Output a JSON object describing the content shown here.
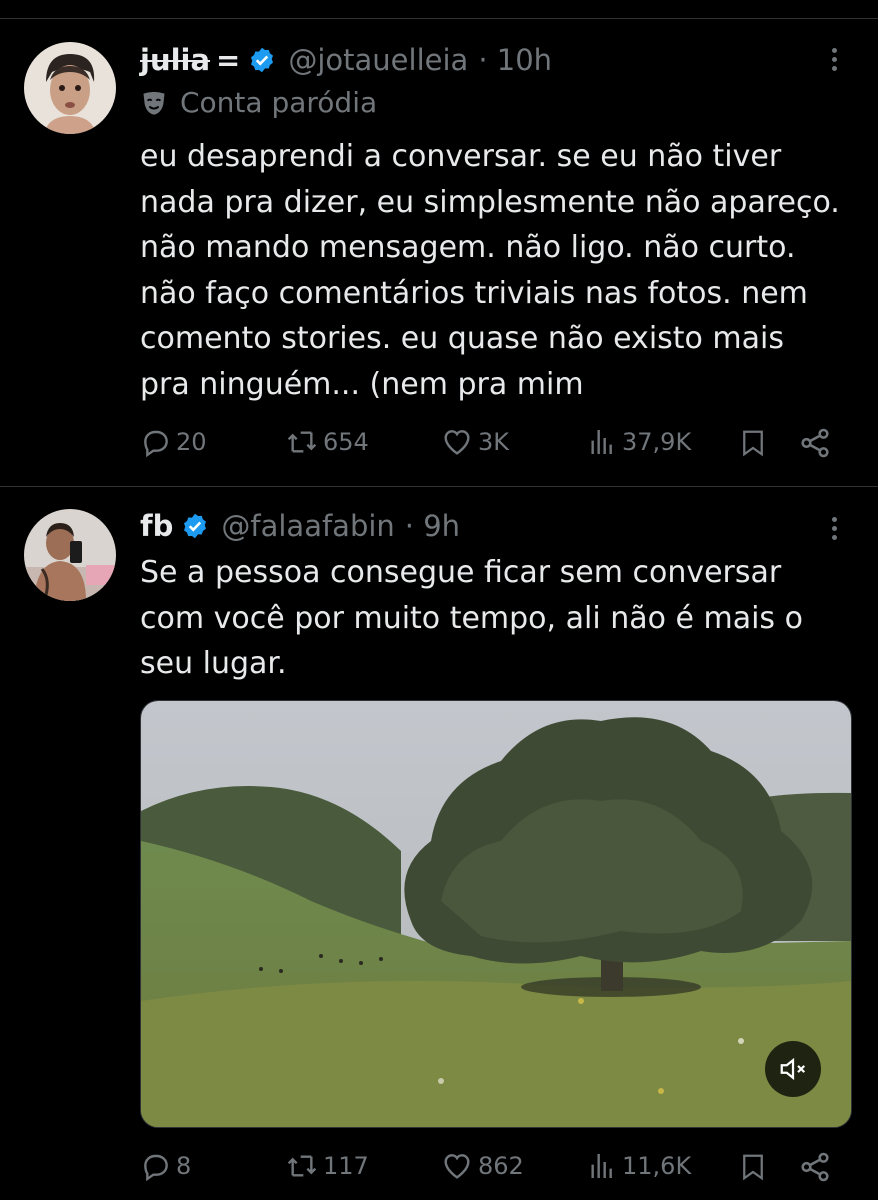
{
  "tweets": [
    {
      "name": "julia",
      "name_suffix": "=",
      "handle": "@jotauelleia",
      "time": "· 10h",
      "parody_label": "Conta paródia",
      "text": "eu desaprendi a conversar. se eu não tiver nada pra dizer, eu simplesmente não apareço. não mando mensagem. não ligo. não curto. não faço comentários triviais nas fotos. nem comento stories. eu quase não existo mais pra ninguém... (nem pra mim",
      "replies": "20",
      "retweets": "654",
      "likes": "3K",
      "views": "37,9K"
    },
    {
      "name": "fb",
      "handle": "@falaafabin",
      "time": "· 9h",
      "text": "Se a pessoa consegue ficar sem conversar com você por muito tempo, ali não é mais o seu lugar.",
      "replies": "8",
      "retweets": "117",
      "likes": "862",
      "views": "11,6K"
    }
  ],
  "colors": {
    "background": "#000000",
    "text": "#e7e9ea",
    "secondary": "#71767b",
    "verified": "#1d9bf0",
    "divider": "#2f3336"
  },
  "icons": [
    "verified-badge-icon",
    "more-icon",
    "parody-mask-icon",
    "reply-icon",
    "retweet-icon",
    "like-icon",
    "views-icon",
    "bookmark-icon",
    "share-icon",
    "mute-icon"
  ]
}
